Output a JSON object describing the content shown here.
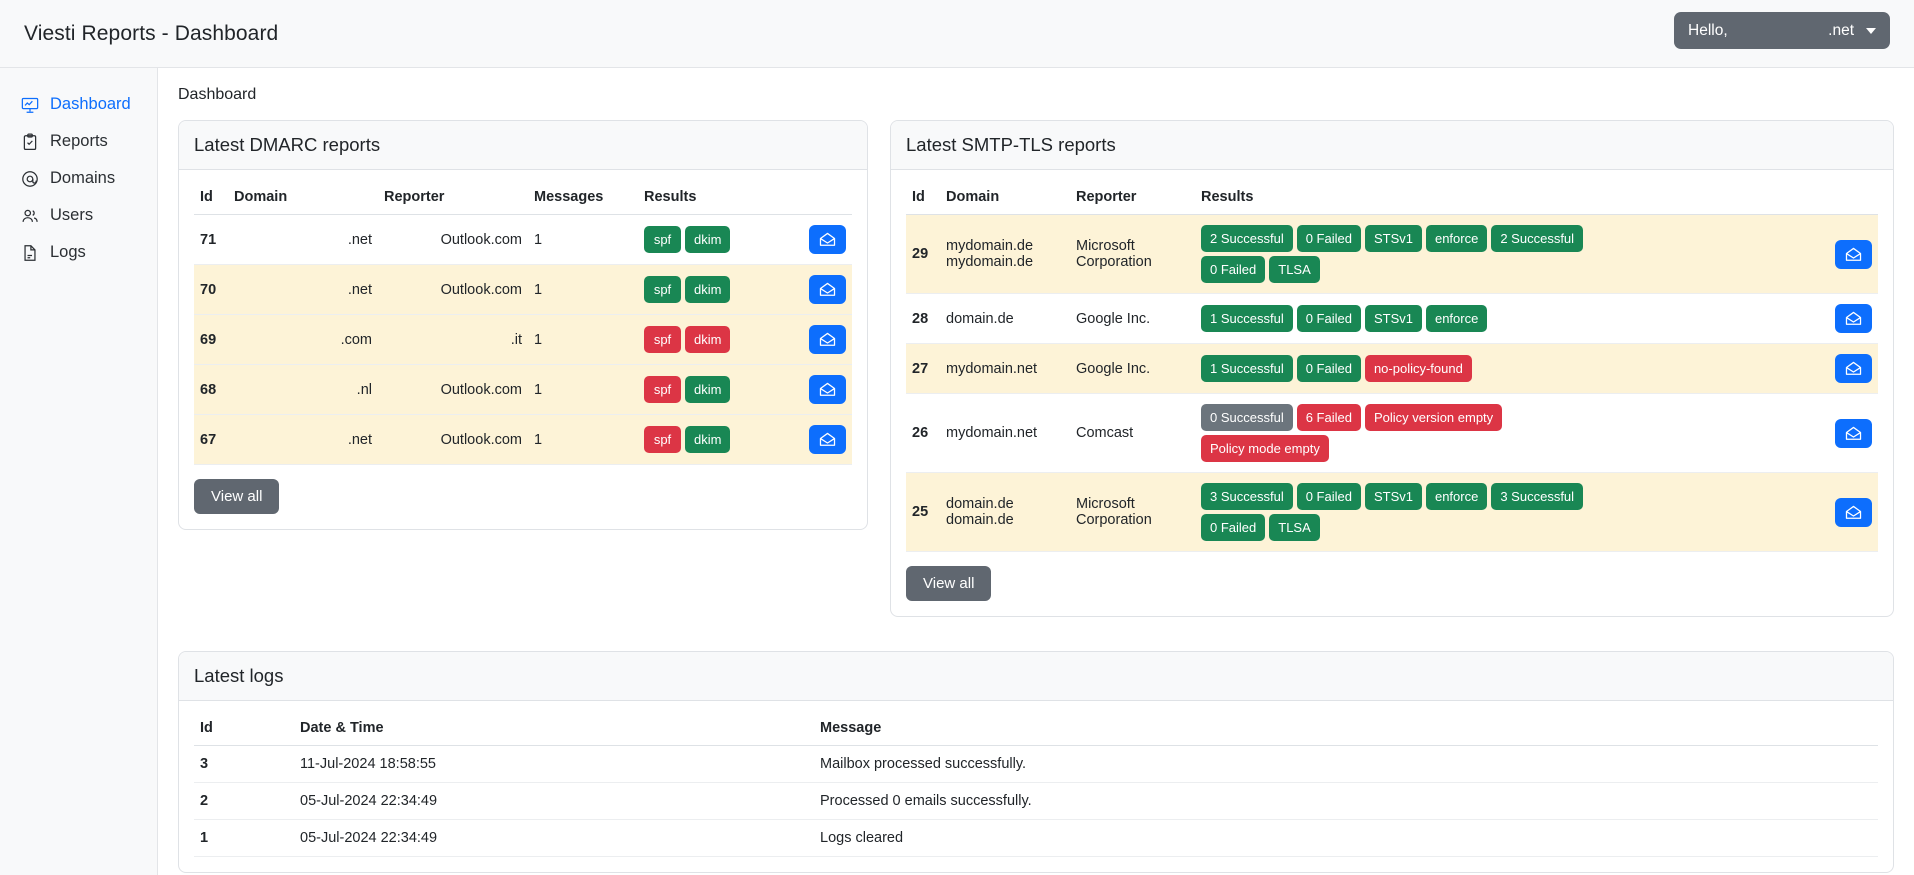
{
  "header": {
    "title": "Viesti Reports - Dashboard",
    "user_menu": {
      "hello_label": "Hello,",
      "username": ".net"
    }
  },
  "sidebar": {
    "items": [
      {
        "label": "Dashboard",
        "icon": "dashboard-chart-icon",
        "active": true
      },
      {
        "label": "Reports",
        "icon": "clipboard-check-icon",
        "active": false
      },
      {
        "label": "Domains",
        "icon": "at-sign-icon",
        "active": false
      },
      {
        "label": "Users",
        "icon": "people-icon",
        "active": false
      },
      {
        "label": "Logs",
        "icon": "document-icon",
        "active": false
      }
    ]
  },
  "breadcrumb": "Dashboard",
  "dmarc": {
    "card_title": "Latest DMARC reports",
    "columns": [
      "Id",
      "Domain",
      "Reporter",
      "Messages",
      "Results",
      ""
    ],
    "view_all_label": "View all",
    "action_icon": "open-envelope-icon",
    "rows": [
      {
        "id": "71",
        "domain": ".net",
        "reporter": "Outlook.com",
        "messages": "1",
        "results": [
          {
            "label": "spf",
            "color": "green"
          },
          {
            "label": "dkim",
            "color": "green"
          }
        ],
        "striped": false
      },
      {
        "id": "70",
        "domain": ".net",
        "reporter": "Outlook.com",
        "messages": "1",
        "results": [
          {
            "label": "spf",
            "color": "green"
          },
          {
            "label": "dkim",
            "color": "green"
          }
        ],
        "striped": true
      },
      {
        "id": "69",
        "domain": ".com",
        "reporter": ".it",
        "messages": "1",
        "results": [
          {
            "label": "spf",
            "color": "red"
          },
          {
            "label": "dkim",
            "color": "red"
          }
        ],
        "striped": true
      },
      {
        "id": "68",
        "domain": ".nl",
        "reporter": "Outlook.com",
        "messages": "1",
        "results": [
          {
            "label": "spf",
            "color": "red"
          },
          {
            "label": "dkim",
            "color": "green"
          }
        ],
        "striped": true
      },
      {
        "id": "67",
        "domain": ".net",
        "reporter": "Outlook.com",
        "messages": "1",
        "results": [
          {
            "label": "spf",
            "color": "red"
          },
          {
            "label": "dkim",
            "color": "green"
          }
        ],
        "striped": true
      }
    ]
  },
  "smtptls": {
    "card_title": "Latest SMTP-TLS reports",
    "columns": [
      "Id",
      "Domain",
      "Reporter",
      "Results",
      ""
    ],
    "view_all_label": "View all",
    "action_icon": "open-envelope-icon",
    "rows": [
      {
        "id": "29",
        "domain": "mydomain.de\nmydomain.de",
        "reporter": "Microsoft Corporation",
        "results": [
          {
            "label": "2 Successful",
            "color": "green"
          },
          {
            "label": "0 Failed",
            "color": "green"
          },
          {
            "label": "STSv1",
            "color": "green"
          },
          {
            "label": "enforce",
            "color": "green"
          },
          {
            "label": "2 Successful",
            "color": "green"
          },
          {
            "label": "0 Failed",
            "color": "green"
          },
          {
            "label": "TLSA",
            "color": "green"
          }
        ],
        "striped": true
      },
      {
        "id": "28",
        "domain": "domain.de",
        "reporter": "Google Inc.",
        "results": [
          {
            "label": "1 Successful",
            "color": "green"
          },
          {
            "label": "0 Failed",
            "color": "green"
          },
          {
            "label": "STSv1",
            "color": "green"
          },
          {
            "label": "enforce",
            "color": "green"
          }
        ],
        "striped": false
      },
      {
        "id": "27",
        "domain": "mydomain.net",
        "reporter": "Google Inc.",
        "results": [
          {
            "label": "1 Successful",
            "color": "green"
          },
          {
            "label": "0 Failed",
            "color": "green"
          },
          {
            "label": "no-policy-found",
            "color": "red"
          }
        ],
        "striped": true
      },
      {
        "id": "26",
        "domain": "mydomain.net",
        "reporter": "Comcast",
        "results": [
          {
            "label": "0 Successful",
            "color": "gray"
          },
          {
            "label": "6 Failed",
            "color": "red"
          },
          {
            "label": "Policy version empty",
            "color": "red"
          },
          {
            "label": "Policy mode empty",
            "color": "red"
          }
        ],
        "striped": false
      },
      {
        "id": "25",
        "domain": "domain.de\ndomain.de",
        "reporter": "Microsoft Corporation",
        "results": [
          {
            "label": "3 Successful",
            "color": "green"
          },
          {
            "label": "0 Failed",
            "color": "green"
          },
          {
            "label": "STSv1",
            "color": "green"
          },
          {
            "label": "enforce",
            "color": "green"
          },
          {
            "label": "3 Successful",
            "color": "green"
          },
          {
            "label": "0 Failed",
            "color": "green"
          },
          {
            "label": "TLSA",
            "color": "green"
          }
        ],
        "striped": true
      }
    ]
  },
  "logs": {
    "card_title": "Latest logs",
    "columns": [
      "Id",
      "Date & Time",
      "Message"
    ],
    "rows": [
      {
        "id": "3",
        "datetime": "11-Jul-2024 18:58:55",
        "message": "Mailbox processed successfully."
      },
      {
        "id": "2",
        "datetime": "05-Jul-2024 22:34:49",
        "message": "Processed 0 emails successfully."
      },
      {
        "id": "1",
        "datetime": "05-Jul-2024 22:34:49",
        "message": "Logs cleared"
      }
    ]
  },
  "colors": {
    "accent_blue": "#0d6efd",
    "success_green": "#198754",
    "danger_red": "#dc3545",
    "muted_gray": "#6c757d",
    "row_highlight": "#fdf3d7"
  }
}
